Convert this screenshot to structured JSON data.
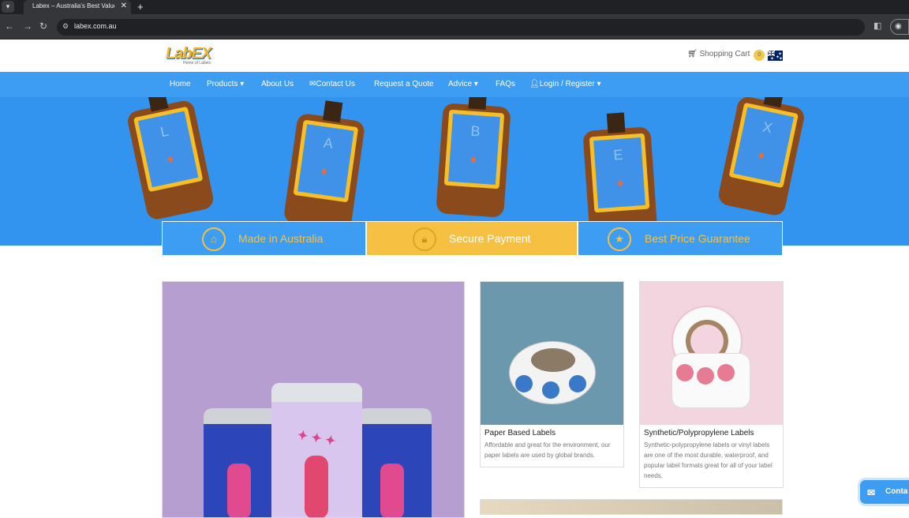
{
  "browser": {
    "tab_title": "Labex – Australia's Best Value C",
    "url": "labex.com.au"
  },
  "header": {
    "logo_text": "LabEX",
    "logo_tagline": "Home of Labels",
    "cart_label": "Shopping Cart",
    "cart_count": "0"
  },
  "nav": {
    "items": [
      "Home",
      "Products ▾",
      "About Us",
      "Contact Us",
      "Request a Quote",
      "Advice ▾",
      "FAQs",
      "Login / Register ▾"
    ]
  },
  "hero": {
    "letters": [
      "L",
      "A",
      "B",
      "E",
      "X"
    ]
  },
  "trust": {
    "items": [
      "Made in Australia",
      "Secure Payment",
      "Best Price Guarantee"
    ]
  },
  "products": [
    {
      "title": "Paper Based Labels",
      "desc": "Affordable and great for the environment, our paper labels are used by global brands."
    },
    {
      "title": "Synthetic/Polypropylene Labels",
      "desc": "Synthetic-polypropylene labels or vinyl labels are one of the most durable, waterproof, and popular label formats great for all of your label needs."
    }
  ],
  "contact_button": "Conta",
  "colors": {
    "brand_blue": "#3d9df2",
    "brand_yellow": "#f6c142"
  }
}
